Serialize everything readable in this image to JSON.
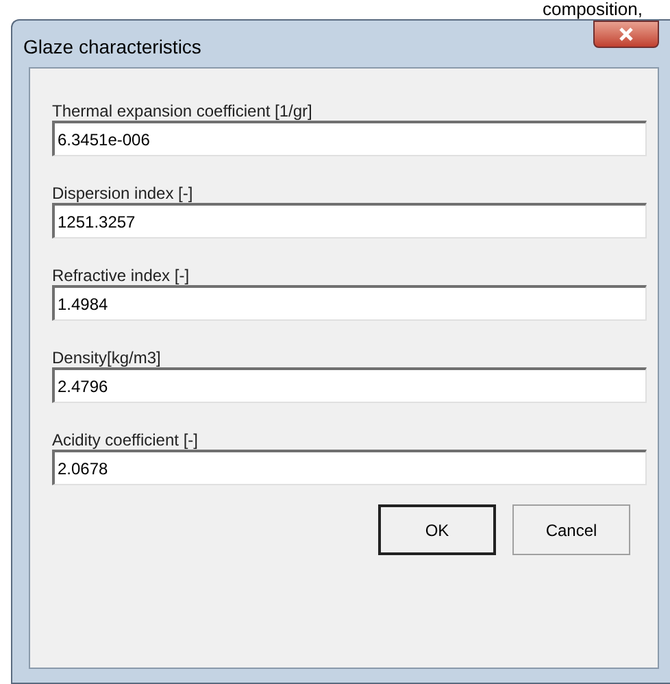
{
  "background_text": "composition,",
  "window": {
    "title": "Glaze characteristics"
  },
  "fields": [
    {
      "label": "Thermal expansion coefficient [1/gr]",
      "value": "6.3451e-006"
    },
    {
      "label": "Dispersion index [-]",
      "value": "1251.3257"
    },
    {
      "label": "Refractive index [-]",
      "value": "1.4984"
    },
    {
      "label": "Density[kg/m3]",
      "value": "2.4796"
    },
    {
      "label": "Acidity coefficient [-]",
      "value": "2.0678"
    }
  ],
  "buttons": [
    {
      "label": "OK",
      "default": true
    },
    {
      "label": "Cancel",
      "default": false
    }
  ]
}
